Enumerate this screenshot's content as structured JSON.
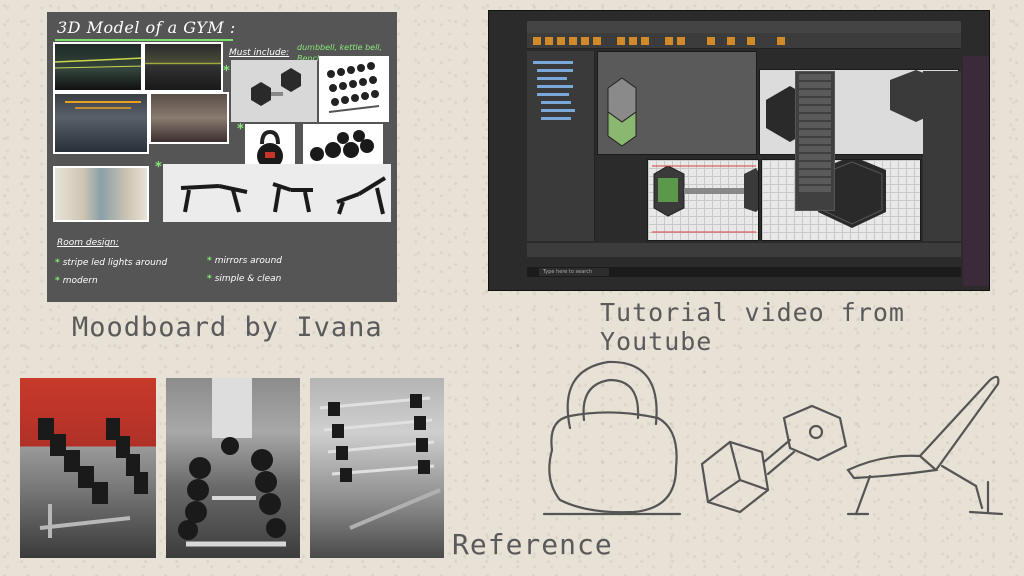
{
  "moodboard": {
    "title": "3D Model of a GYM :",
    "must_include_label": "Must include:",
    "must_include_items": "dumbbell, kettle bell, Bench",
    "room_design_label": "Room design:",
    "room_design_items": [
      "stripe led lights around",
      "modern",
      "mirrors around",
      "simple & clean"
    ],
    "accent_color": "#8ae87a"
  },
  "screenshot": {
    "search_placeholder": "Type here to search"
  },
  "captions": {
    "moodboard": "Moodboard by Ivana",
    "tutorial": "Tutorial video from Youtube",
    "reference": "Reference"
  }
}
